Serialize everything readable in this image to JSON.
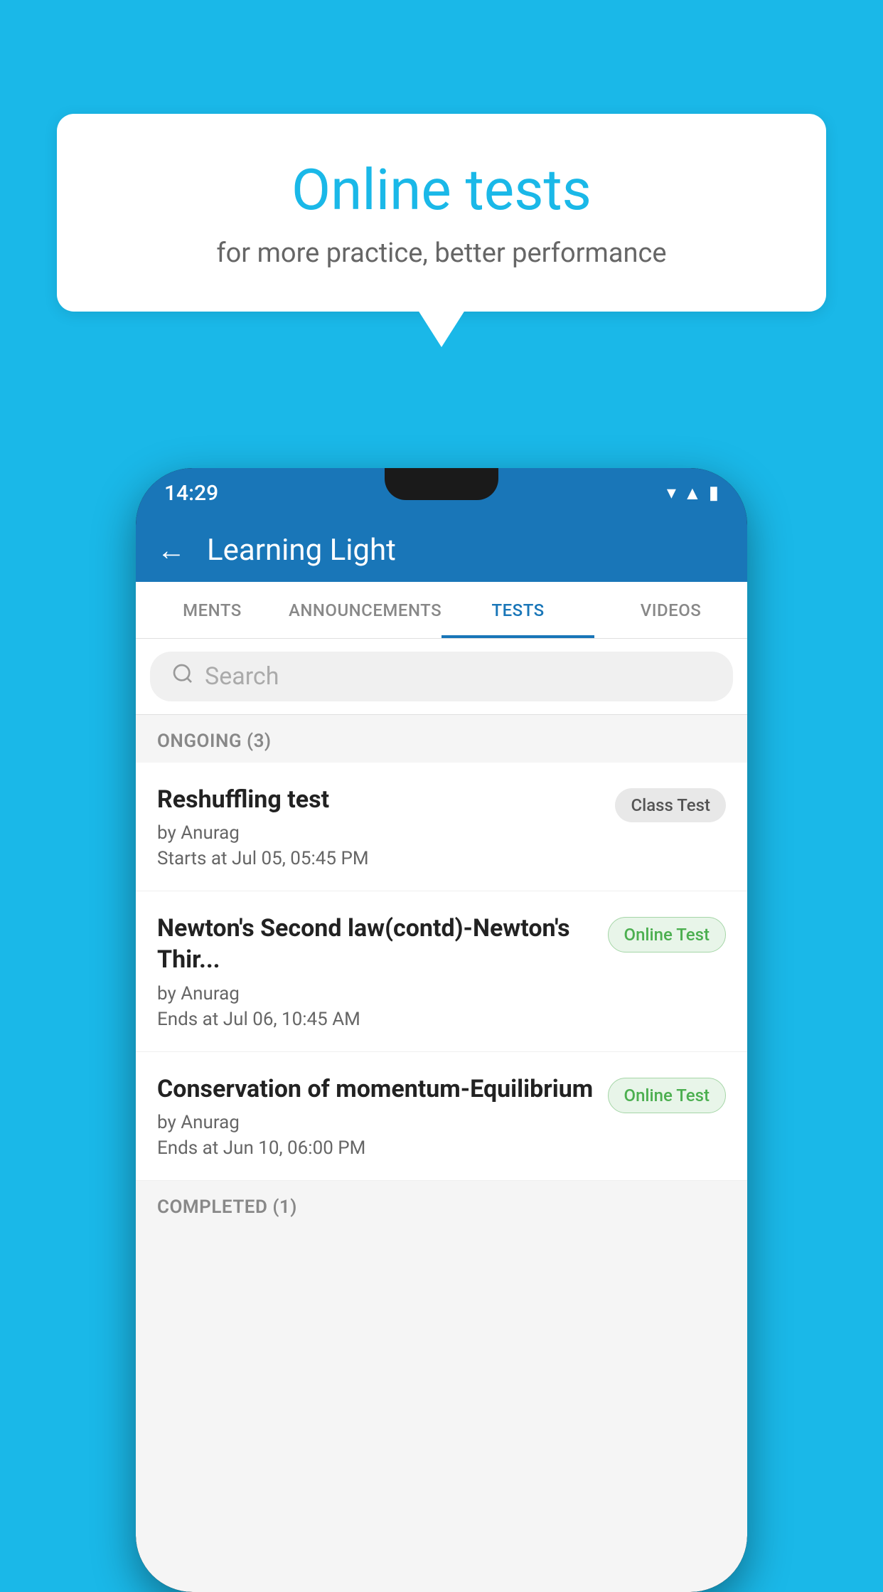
{
  "background_color": "#1ab8e8",
  "bubble": {
    "title": "Online tests",
    "subtitle": "for more practice, better performance"
  },
  "phone": {
    "status_bar": {
      "time": "14:29",
      "wifi_icon": "▾",
      "signal_icon": "▲",
      "battery_icon": "▮"
    },
    "header": {
      "back_label": "←",
      "title": "Learning Light"
    },
    "tabs": [
      {
        "label": "MENTS",
        "active": false
      },
      {
        "label": "ANNOUNCEMENTS",
        "active": false
      },
      {
        "label": "TESTS",
        "active": true
      },
      {
        "label": "VIDEOS",
        "active": false
      }
    ],
    "search": {
      "placeholder": "Search"
    },
    "ongoing_section": {
      "label": "ONGOING (3)"
    },
    "test_items": [
      {
        "name": "Reshuffling test",
        "author": "by Anurag",
        "time_label": "Starts at",
        "time": "Jul 05, 05:45 PM",
        "badge": "Class Test",
        "badge_type": "class"
      },
      {
        "name": "Newton's Second law(contd)-Newton's Thir...",
        "author": "by Anurag",
        "time_label": "Ends at",
        "time": "Jul 06, 10:45 AM",
        "badge": "Online Test",
        "badge_type": "online"
      },
      {
        "name": "Conservation of momentum-Equilibrium",
        "author": "by Anurag",
        "time_label": "Ends at",
        "time": "Jun 10, 06:00 PM",
        "badge": "Online Test",
        "badge_type": "online"
      }
    ],
    "completed_section": {
      "label": "COMPLETED (1)"
    }
  }
}
